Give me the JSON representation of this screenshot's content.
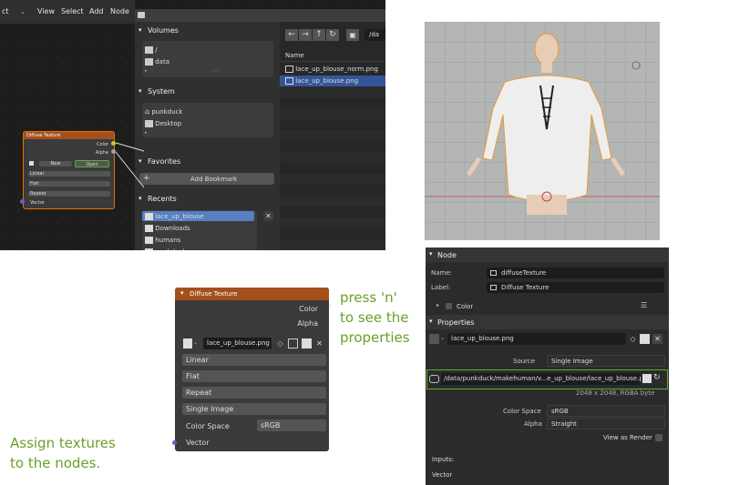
{
  "node_editor": {
    "menu": [
      "ct",
      "View",
      "Select",
      "Add",
      "Node"
    ],
    "node": {
      "title": "Diffuse Texture",
      "out_color": "Color",
      "out_alpha": "Alpha",
      "new": "New",
      "open": "Open",
      "dropdowns": [
        "Linear",
        "Flat",
        "Repeat"
      ],
      "vector": "Vector"
    }
  },
  "file_browser": {
    "path": "/da",
    "sections": {
      "volumes": "Volumes",
      "system": "System",
      "favorites": "Favorites",
      "recents": "Recents"
    },
    "volumes": [
      "/",
      "data"
    ],
    "system": [
      "punkduck",
      "Desktop"
    ],
    "add_bookmark": "Add Bookmark",
    "recents": [
      "lace_up_blouse",
      "Downloads",
      "humans",
      "punkduck"
    ],
    "column_name": "Name",
    "files": [
      "lace_up_blouse_norm.png",
      "lace_up_blouse.png"
    ],
    "selected_file": "lace_up_blouse.png",
    "grip": ":::::"
  },
  "zoom_node": {
    "title": "Diffuse Texture",
    "out_color": "Color",
    "out_alpha": "Alpha",
    "image_name": "lace_up_blouse.png",
    "dropdowns": [
      "Linear",
      "Flat",
      "Repeat",
      "Single Image"
    ],
    "color_space_label": "Color Space",
    "color_space": "sRGB",
    "vector": "Vector"
  },
  "annotations": {
    "press_n": [
      "press 'n'",
      "to see the",
      "properties"
    ],
    "assign": [
      "Assign textures",
      "to the nodes."
    ],
    "color": "#6c9f2a"
  },
  "properties": {
    "node_section": "Node",
    "name_label": "Name:",
    "name_value": "diffuseTexture",
    "label_label": "Label:",
    "label_value": "Diffuse Texture",
    "color_label": "Color",
    "properties_section": "Properties",
    "image_name": "lace_up_blouse.png",
    "source_label": "Source",
    "source_value": "Single Image",
    "filepath": "/data/punkduck/makehuman/v...e_up_blouse/lace_up_blouse.png",
    "resolution": "2048 x 2048,  RGBA byte",
    "color_space_label": "Color Space",
    "color_space": "sRGB",
    "alpha_label": "Alpha",
    "alpha_value": "Straight",
    "view_as_render": "View as Render",
    "inputs": "Inputs:",
    "vector": "Vector"
  }
}
